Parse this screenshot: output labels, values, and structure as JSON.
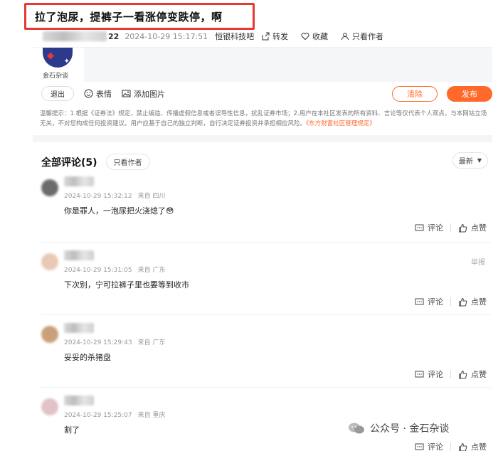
{
  "headline": "拉了泡尿，提裤子一看涨停变跌停，啊",
  "post": {
    "user_suffix": "22",
    "date": "2024-10-29 15:17:51",
    "bar_name": "恒银科技吧",
    "actions": {
      "share": "转发",
      "favorite": "收藏",
      "only_author": "只看作者"
    }
  },
  "compose": {
    "avatar_name": "金石杂谈",
    "exit": "退出",
    "emoji": "表情",
    "add_image": "添加图片",
    "clear": "清除",
    "post": "发布",
    "notice": "温馨提示：1.根据《证券法》规定，禁止编造、传播虚假信息或者误导性信息，扰乱证券市场；2.用户在本社区发表的所有资料、言论等仅代表个人观点，与本网站立场无关，不对您构成任何投资建议。用户应基于自己的独立判断，自行决定证券投资并承担相应风险。",
    "notice_link": "《东方财富社区管理规定》"
  },
  "comments": {
    "title": "全部评论(5)",
    "only_author": "只看作者",
    "sort": "最新",
    "report": "举报",
    "reply_label": "评论",
    "like_label": "点赞",
    "items": [
      {
        "date": "2024-10-29 15:32:12",
        "location": "来自 四川",
        "text": "你是罪人，一泡尿把火浇熄了😳"
      },
      {
        "date": "2024-10-29 15:31:05",
        "location": "来自 广东",
        "text": "下次别，宁可拉裤子里也要等到收市"
      },
      {
        "date": "2024-10-29 15:29:43",
        "location": "来自 广东",
        "text": "妥妥的杀猪盘"
      },
      {
        "date": "2024-10-29 15:25:07",
        "location": "来自 重庆",
        "text": "割了"
      }
    ]
  },
  "watermark": "公众号 · 金石杂谈",
  "colors": {
    "accent": "#ff6a2a",
    "highlight_border": "#e53935"
  }
}
